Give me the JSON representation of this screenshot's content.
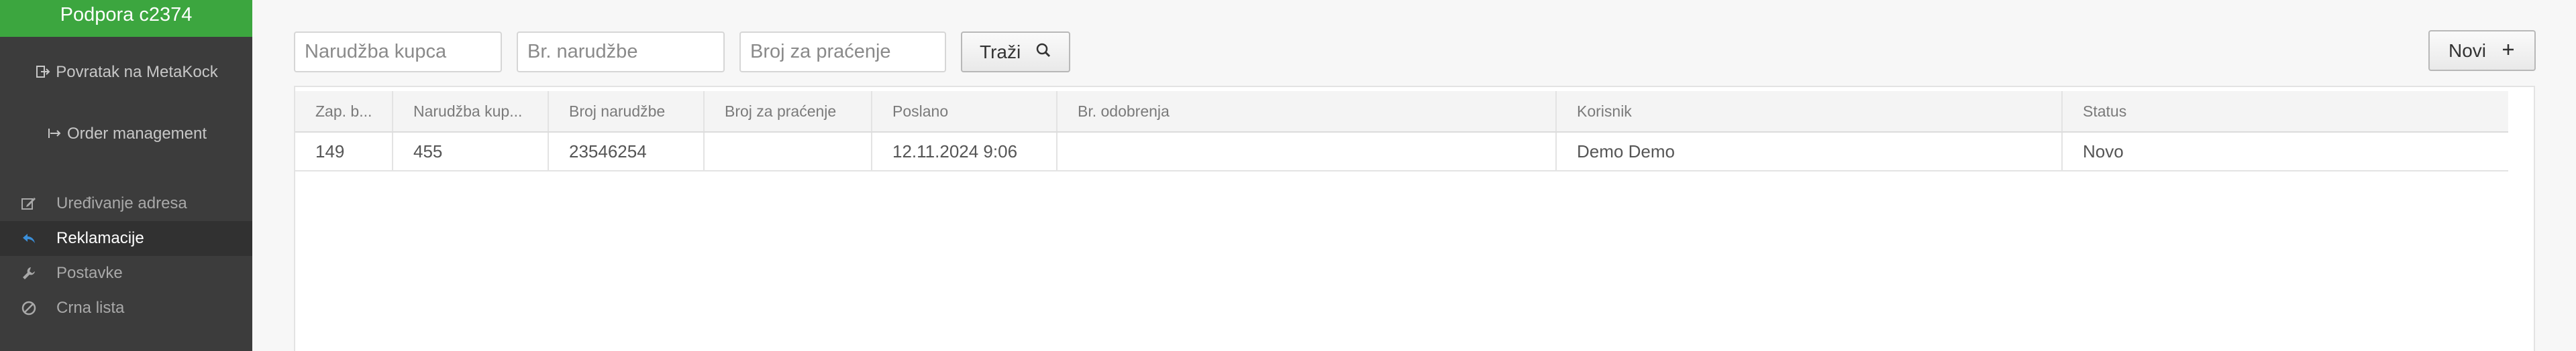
{
  "sidebar": {
    "brand": "Podpora c2374",
    "back_label": "Povratak na MetaKock",
    "order_label": "Order management",
    "items": [
      {
        "label": "Uređivanje adresa",
        "icon": "edit-icon",
        "active": false
      },
      {
        "label": "Reklamacije",
        "icon": "reply-icon",
        "active": true
      },
      {
        "label": "Postavke",
        "icon": "wrench-icon",
        "active": false
      },
      {
        "label": "Crna lista",
        "icon": "ban-icon",
        "active": false
      }
    ]
  },
  "toolbar": {
    "customer_order_placeholder": "Narudžba kupca",
    "order_number_placeholder": "Br. narudžbe",
    "tracking_placeholder": "Broj za praćenje",
    "search_label": "Traži",
    "new_label": "Novi"
  },
  "table": {
    "columns": [
      "Zap. b...",
      "Narudžba kup...",
      "Broj narudžbe",
      "Broj za praćenje",
      "Poslano",
      "Br. odobrenja",
      "Korisnik",
      "Status"
    ],
    "rows": [
      [
        "149",
        "455",
        "23546254",
        "",
        "12.11.2024 9:06",
        "",
        "Demo Demo",
        "Novo"
      ]
    ]
  },
  "colors": {
    "brand_green": "#3ca63f",
    "sidebar_bg": "#3c3c3c",
    "active_icon": "#3b8fd9"
  }
}
